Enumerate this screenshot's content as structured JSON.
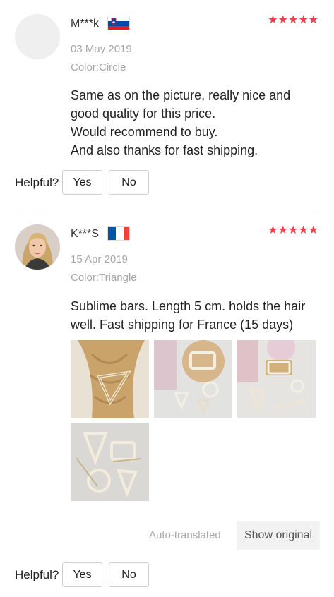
{
  "reviews": [
    {
      "author": "M***k",
      "flag": "slovenia-flag",
      "rating": 5,
      "stars": "★★★★★",
      "date": "03 May 2019",
      "color": "Color:Circle",
      "text": [
        "Same as on the picture, really nice and",
        "good quality for this price.",
        "Would recommend to buy.",
        "And also thanks for fast shipping."
      ],
      "helpful_label": "Helpful?",
      "yes_label": "Yes",
      "no_label": "No"
    },
    {
      "author": "K***S",
      "flag": "france-flag",
      "rating": 5,
      "stars": "★★★★★",
      "date": "15 Apr 2019",
      "color": "Color:Triangle",
      "text": [
        "Sublime bars. Length 5 cm. holds the hair",
        "well. Fast shipping for France (15 days)"
      ],
      "photos": [
        "hair-clip-photo",
        "clips-on-table-photo",
        "clips-with-candle-photo",
        "clips-closeup-photo"
      ],
      "translated_label": "Auto-translated",
      "show_original_label": "Show original",
      "helpful_label": "Helpful?",
      "yes_label": "Yes",
      "no_label": "No"
    }
  ],
  "colors": {
    "star": "#e8424d",
    "muted": "#a6a6a6",
    "divider": "#e6e6e6"
  }
}
